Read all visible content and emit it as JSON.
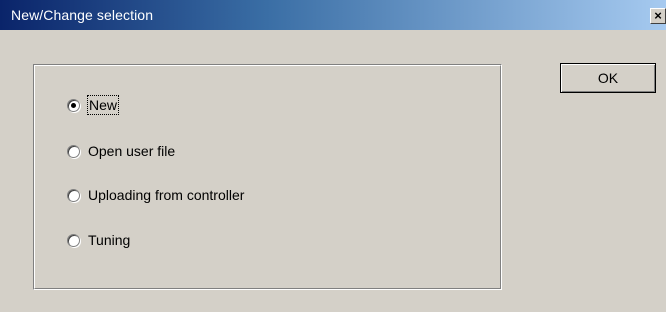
{
  "window": {
    "title": "New/Change selection",
    "close_glyph": "×",
    "close_icon": "close-icon"
  },
  "options": [
    {
      "label": "New",
      "checked": true,
      "focused": true
    },
    {
      "label": "Open user file",
      "checked": false,
      "focused": false
    },
    {
      "label": "Uploading from controller",
      "checked": false,
      "focused": false
    },
    {
      "label": "Tuning",
      "checked": false,
      "focused": false
    }
  ],
  "buttons": {
    "ok_label": "OK"
  },
  "colors": {
    "title_start": "#0a246a",
    "title_end": "#a6caf0",
    "face": "#d4d0c8"
  }
}
